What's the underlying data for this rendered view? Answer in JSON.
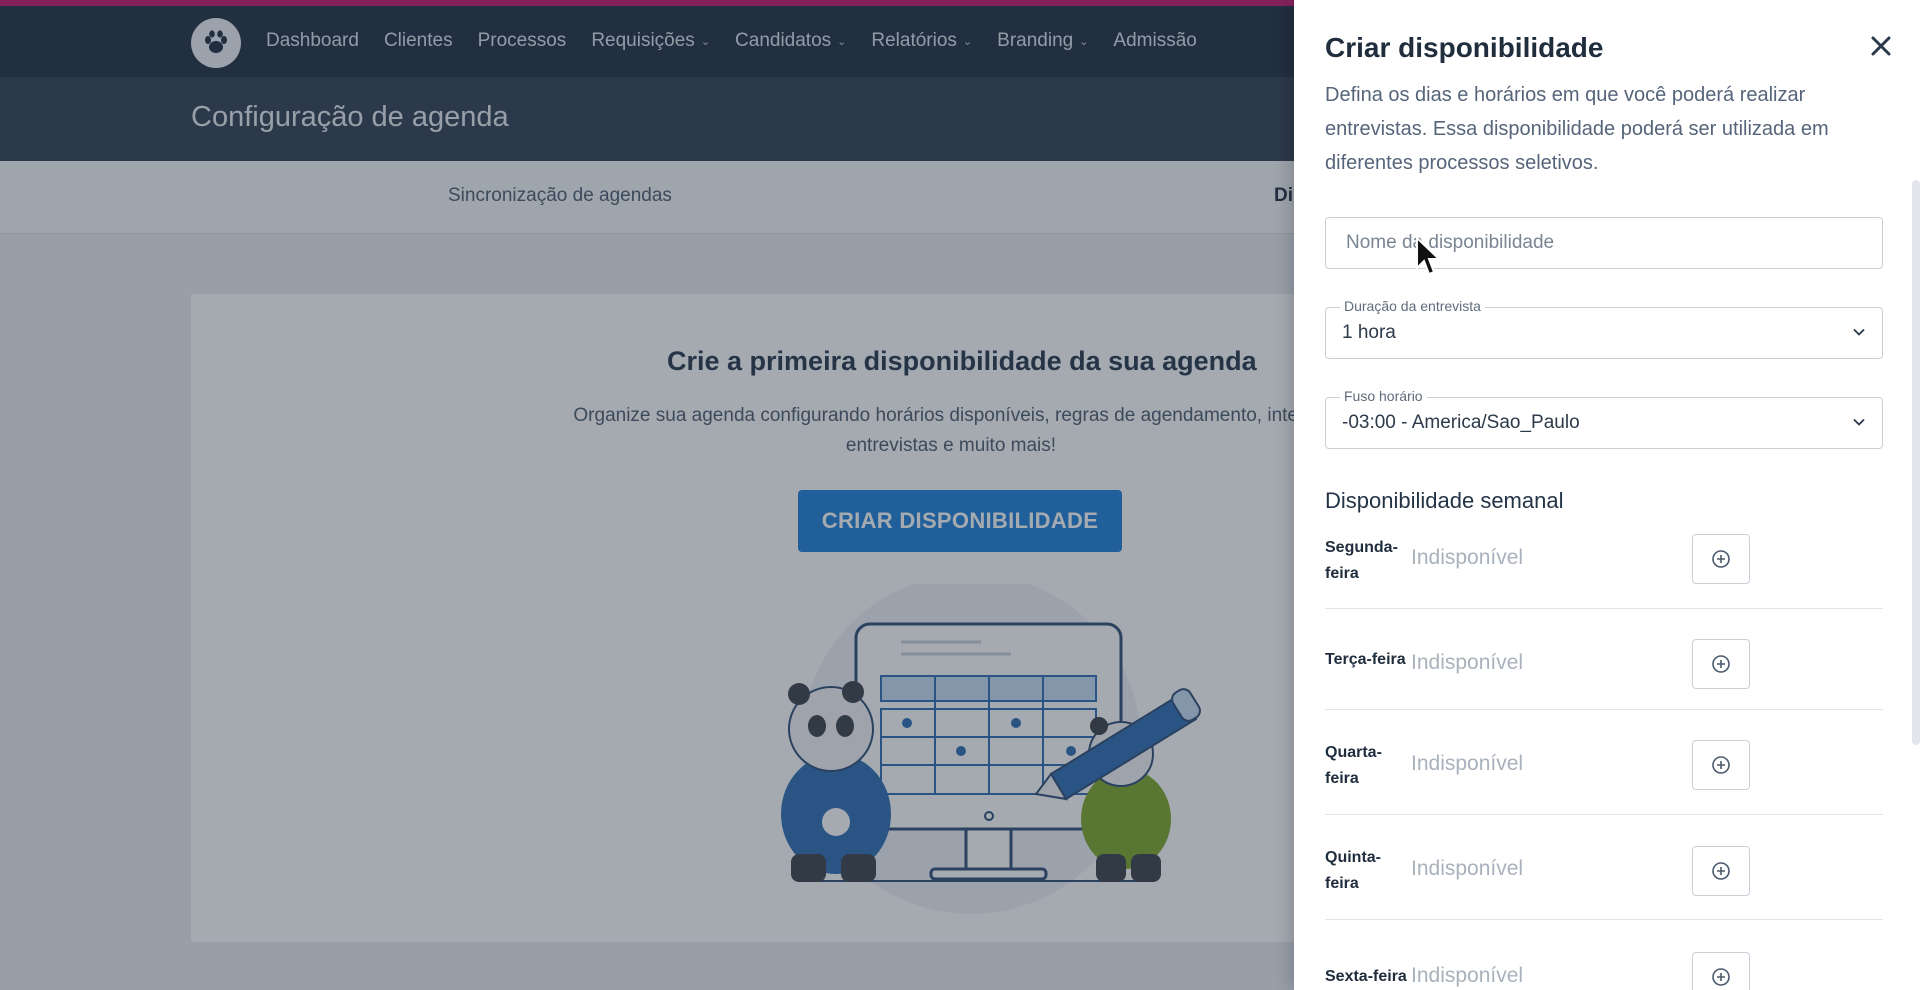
{
  "topbar": {
    "accent_color": "#c6166e",
    "nav": [
      {
        "label": "Dashboard",
        "has_menu": false
      },
      {
        "label": "Clientes",
        "has_menu": false
      },
      {
        "label": "Processos",
        "has_menu": false
      },
      {
        "label": "Requisições",
        "has_menu": true
      },
      {
        "label": "Candidatos",
        "has_menu": true
      },
      {
        "label": "Relatórios",
        "has_menu": true
      },
      {
        "label": "Branding",
        "has_menu": true
      },
      {
        "label": "Admissão",
        "has_menu": false
      }
    ]
  },
  "page": {
    "title": "Configuração de agenda",
    "tabs": {
      "sync": "Sincronização de agendas",
      "availability": "Di"
    }
  },
  "empty_state": {
    "title": "Crie a primeira disponibilidade da sua agenda",
    "description_line1": "Organize sua agenda configurando horários disponíveis, regras de agendamento, interval",
    "description_line2": "entrevistas e muito mais!",
    "cta_label": "CRIAR DISPONIBILIDADE"
  },
  "drawer": {
    "title": "Criar disponibilidade",
    "description": "Defina os dias e horários em que você poderá realizar entrevistas. Essa disponibilidade poderá ser utilizada em diferentes processos seletivos.",
    "name_placeholder": "Nome da disponibilidade",
    "duration": {
      "label": "Duração da entrevista",
      "value": "1 hora"
    },
    "timezone": {
      "label": "Fuso horário",
      "value": "-03:00 - America/Sao_Paulo"
    },
    "weekly_title": "Disponibilidade semanal",
    "days": [
      {
        "name_line1": "Segunda-",
        "name_line2": "feira",
        "status": "Indisponível"
      },
      {
        "name_line1": "Terça-feira",
        "name_line2": "",
        "status": "Indisponível"
      },
      {
        "name_line1": "Quarta-",
        "name_line2": "feira",
        "status": "Indisponível"
      },
      {
        "name_line1": "Quinta-",
        "name_line2": "feira",
        "status": "Indisponível"
      },
      {
        "name_line1": "Sexta-feira",
        "name_line2": "",
        "status": "Indisponível"
      }
    ]
  }
}
